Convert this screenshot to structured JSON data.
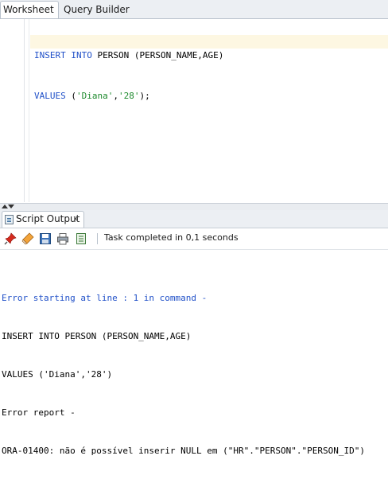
{
  "tabs": {
    "worksheet": "Worksheet",
    "query_builder": "Query Builder"
  },
  "editor": {
    "line1_kw": "INSERT INTO",
    "line1_rest": " PERSON (PERSON_NAME,AGE)",
    "line2_kw": "VALUES",
    "line2_open": " (",
    "line2_str1": "'Diana'",
    "line2_comma": ",",
    "line2_str2": "'28'",
    "line2_close": ");"
  },
  "output_panel": {
    "tab_label": "Script Output",
    "close_glyph": "x",
    "status": "Task completed in 0,1 seconds",
    "toolbar_icons": [
      "pin-icon",
      "eraser-icon",
      "save-icon",
      "print-icon",
      "log-icon"
    ],
    "lines": {
      "error_start": "Error starting at line : 1 in command -",
      "stmt1": "INSERT INTO PERSON (PERSON_NAME,AGE)",
      "stmt2": "VALUES ('Diana','28')",
      "report": "Error report -",
      "ora": "ORA-01400: não é possível inserir NULL em (\"HR\".\"PERSON\".\"PERSON_ID\")"
    }
  },
  "colors": {
    "keyword": "#2050c8",
    "string": "#1e8a2e",
    "current_line": "#fdf7e2"
  }
}
